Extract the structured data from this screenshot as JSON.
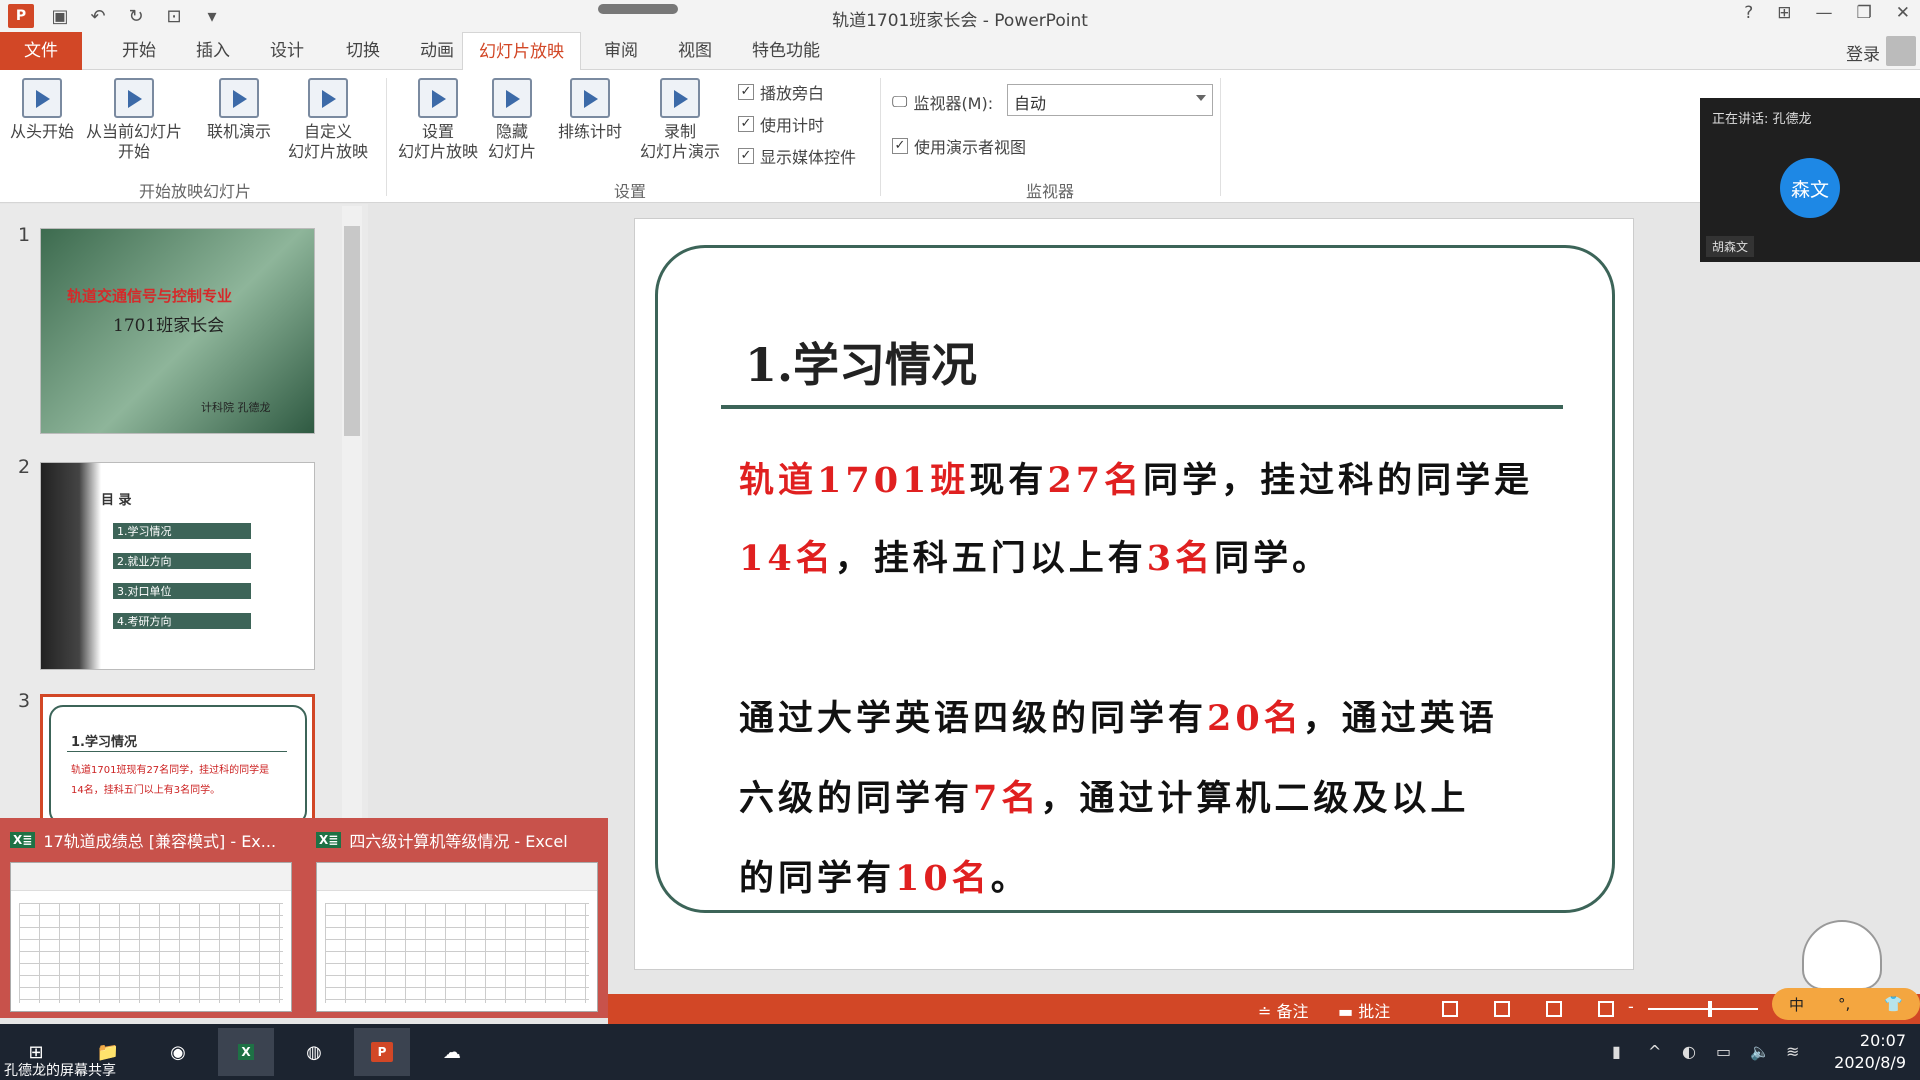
{
  "window": {
    "title": "轨道1701班家长会 - PowerPoint",
    "login": "登录"
  },
  "tabs": [
    "文件",
    "开始",
    "插入",
    "设计",
    "切换",
    "动画",
    "幻灯片放映",
    "审阅",
    "视图",
    "特色功能"
  ],
  "ribbon": {
    "btn_from_start": "从头开始",
    "btn_from_current_1": "从当前幻灯片",
    "btn_from_current_2": "开始",
    "btn_online": "联机演示",
    "btn_custom_1": "自定义",
    "btn_custom_2": "幻灯片放映",
    "group_start": "开始放映幻灯片",
    "btn_setup_1": "设置",
    "btn_setup_2": "幻灯片放映",
    "btn_hide_1": "隐藏",
    "btn_hide_2": "幻灯片",
    "btn_rehearse": "排练计时",
    "btn_record_1": "录制",
    "btn_record_2": "幻灯片演示",
    "chk_narration": "播放旁白",
    "chk_timing": "使用计时",
    "chk_media": "显示媒体控件",
    "group_setup": "设置",
    "monitor_label": "监视器(M):",
    "monitor_value": "自动",
    "chk_presenter": "使用演示者视图",
    "group_monitor": "监视器"
  },
  "meeting": {
    "speaking": "正在讲话: 孔德龙",
    "avatar": "森文",
    "name": "胡森文"
  },
  "thumbnails": {
    "n1": "1",
    "n2": "2",
    "n3": "3",
    "t1_title": "轨道交通信号与控制专业",
    "t1_sub": "1701班家长会",
    "t1_author": "计科院  孔德龙",
    "t2_title": "目  录",
    "t2_items": [
      "1.学习情况",
      "2.就业方向",
      "3.对口单位",
      "4.考研方向"
    ],
    "t3_title": "1.学习情况",
    "t3_line1": "轨道1701班现有27名同学，挂过科的同学是",
    "t3_line2": "14名，挂科五门以上有3名同学。"
  },
  "slide": {
    "title": "1.学习情况",
    "p1_a": "轨道1701班",
    "p1_b": "现有",
    "p1_c": "27名",
    "p1_d": "同学，挂过科的同学是",
    "p2_a": "14名",
    "p2_b": "，挂科五门以上有",
    "p2_c": "3名",
    "p2_d": "同学。",
    "p3_a": "通过大学英语四级的同学有",
    "p3_b": "20名",
    "p3_c": "，通过英语",
    "p4_a": "六级的同学有",
    "p4_b": "7名",
    "p4_c": "，通过计算机二级及以上",
    "p5_a": "的同学有",
    "p5_b": "10名",
    "p5_c": "。"
  },
  "previews": [
    {
      "badge": "X≣",
      "title": "17轨道成绩总  [兼容模式] - Ex..."
    },
    {
      "badge": "X≣",
      "title": "四六级计算机等级情况 - Excel"
    }
  ],
  "statusbar": {
    "notes": "≐ 备注",
    "comments": "▬ 批注",
    "zoom_minus": "-"
  },
  "ime": {
    "lang": "中",
    "punct": "°,",
    "shirt": "👕"
  },
  "taskbar": {
    "share": "孔德龙的屏幕共享",
    "time": "20:07",
    "date": "2020/8/9"
  }
}
